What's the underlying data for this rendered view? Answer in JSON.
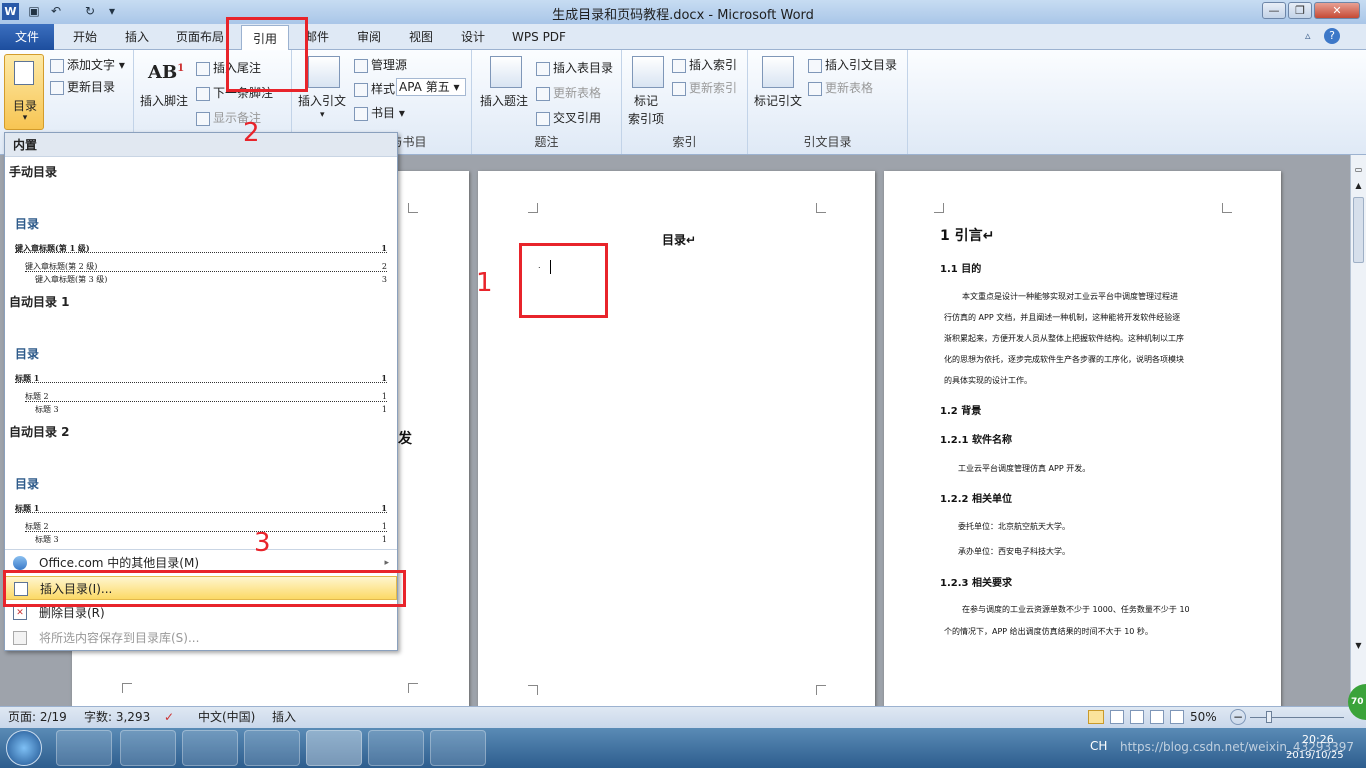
{
  "window": {
    "title": "生成目录和页码教程.docx - Microsoft Word",
    "logo": "W",
    "qat": {
      "save_icon": "save-icon",
      "undo": "↶",
      "redo": "↻",
      "customize": "▾"
    },
    "controls": {
      "minimize": "—",
      "maximize": "❐",
      "close": "✕"
    }
  },
  "tabs": [
    "文件",
    "开始",
    "插入",
    "页面布局",
    "引用",
    "邮件",
    "审阅",
    "视图",
    "设计",
    "WPS PDF"
  ],
  "ribbon": {
    "toc_group": {
      "toc": "目录",
      "add_text": "添加文字",
      "update_toc": "更新目录"
    },
    "footnote_group": {
      "insert_footnote": "插入脚注",
      "insert_endnote": "插入尾注",
      "next_footnote": "下一条脚注",
      "show_notes": "显示备注"
    },
    "citation_group": {
      "insert_citation": "插入引文",
      "manage_sources": "管理源",
      "style_label": "样式:",
      "style_value": "APA 第五",
      "bibliography": "书目",
      "label": "引文与书目"
    },
    "caption_group": {
      "insert_caption": "插入题注",
      "insert_table_figures": "插入表目录",
      "update_table": "更新表格",
      "cross_ref": "交叉引用",
      "label": "题注"
    },
    "index_group": {
      "mark_entry": "标记\n索引项",
      "mark_entry_1": "标记",
      "mark_entry_2": "索引项",
      "insert_index": "插入索引",
      "update_index": "更新索引",
      "label": "索引"
    },
    "toa_group": {
      "mark_citation": "标记引文",
      "insert_toa": "插入引文目录",
      "update_table": "更新表格",
      "label": "引文目录"
    }
  },
  "dropdown": {
    "section": "内置",
    "items": [
      {
        "label": "手动目录",
        "preview_title": "目录",
        "lines": [
          "键入章标题(第 1 级)",
          "键入章标题(第 2 级)",
          "键入章标题(第 3 级)"
        ],
        "nums": [
          "1",
          "2",
          "3"
        ]
      },
      {
        "label": "自动目录 1",
        "preview_title": "目录",
        "lines": [
          "标题 1",
          "标题 2",
          "标题 3"
        ],
        "nums": [
          "1",
          "1",
          "1"
        ]
      },
      {
        "label": "自动目录 2",
        "preview_title": "目录",
        "lines": [
          "标题 1",
          "标题 2",
          "标题 3"
        ],
        "nums": [
          "1",
          "1",
          "1"
        ]
      }
    ],
    "menu": [
      "Office.com 中的其他目录(M)",
      "插入目录(I)...",
      "删除目录(R)",
      "将所选内容保存到目录库(S)..."
    ],
    "submenu_arrow": "▸"
  },
  "annotations": {
    "n1": "1",
    "n2": "2",
    "n3": "3"
  },
  "page2": {
    "heading": "目录↵",
    "marker": "."
  },
  "page3": {
    "h1": "1 引言↵",
    "h11": "1.1 目的",
    "para1": [
      "本文重点是设计一种能够实现对工业云平台中调度管理过程进",
      "行仿真的 APP 文档，并且阐述一种机制，这种能将开发软件经验逐",
      "渐积累起来，方便开发人员从整体上把握软件结构。这种机制以工序",
      "化的思想为依托，逐步完成软件生产各步骤的工序化，说明各项模块",
      "的具体实现的设计工作。"
    ],
    "h12": "1.2 背景",
    "h121": "1.2.1 软件名称",
    "p121": "工业云平台调度管理仿真  APP 开发。",
    "h122": "1.2.2 相关单位",
    "p122a": "委托单位：北京航空航天大学。",
    "p122b": "承办单位：西安电子科技大学。",
    "h123": "1.2.3 相关要求",
    "para3": [
      "在参与调度的工业云资源单数不少于 1000、任务数量不少于 10",
      "个的情况下，APP 给出调度仿真结果的时间不大于   10 秒。"
    ]
  },
  "page1_fragment": {
    "char": "发"
  },
  "status": {
    "page": "页面: 2/19",
    "words": "字数: 3,293",
    "lang": "中文(中国)",
    "mode": "插入",
    "zoom": "50%",
    "zoom_out": "−",
    "zoom_in": "+"
  },
  "taskbar": {
    "time": "20:26",
    "date": "2019/10/25",
    "watermark": "https://blog.csdn.net/weixin_43293397",
    "badge": "70",
    "lang_ind": "CH"
  }
}
